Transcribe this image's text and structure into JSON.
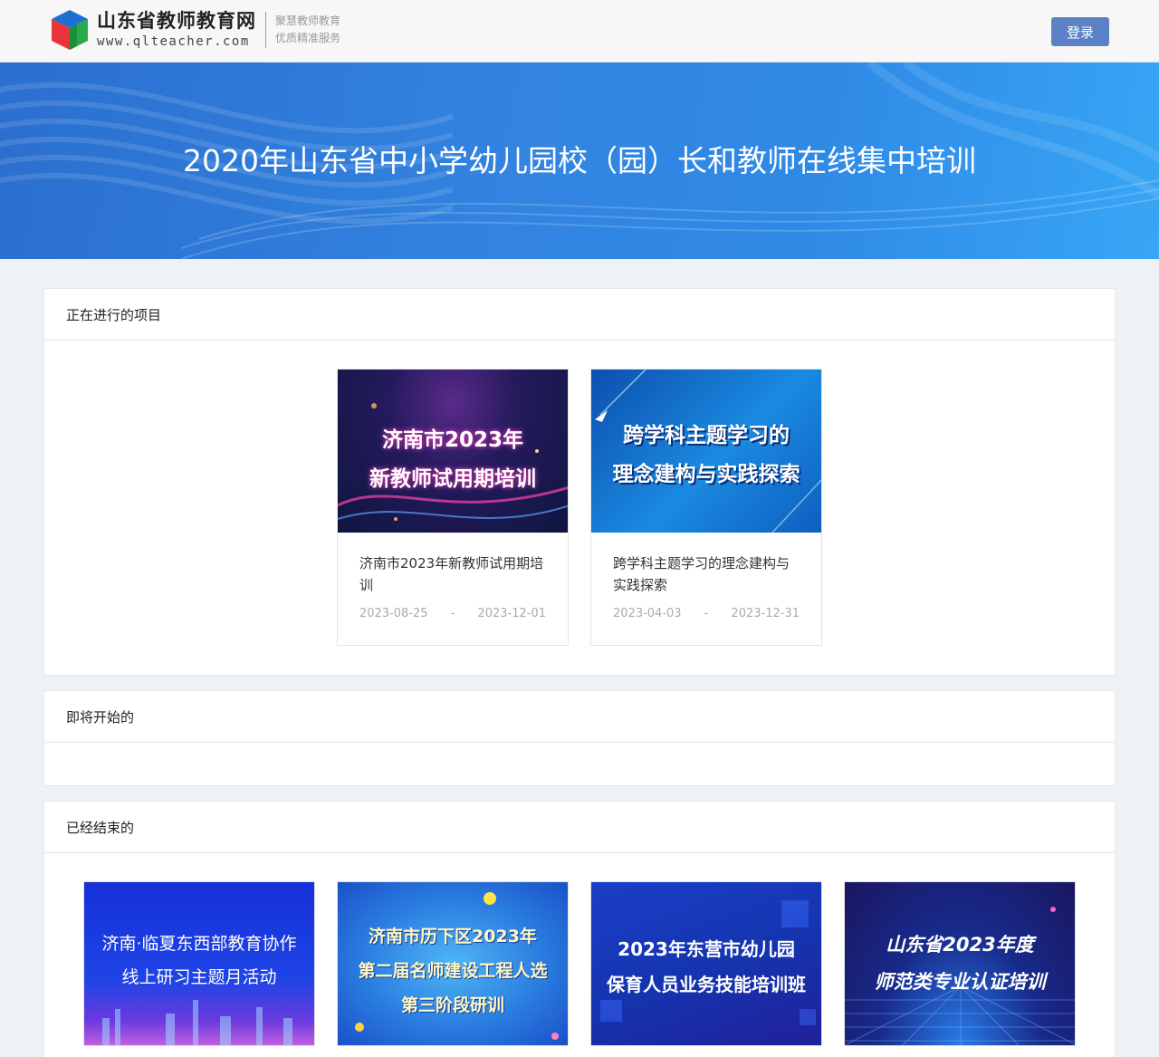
{
  "header": {
    "site_name": "山东省教师教育网",
    "site_url": "www.qlteacher.com",
    "slogan_line1": "聚慧教师教育",
    "slogan_line2": "优质精准服务",
    "login_label": "登录"
  },
  "banner": {
    "title": "2020年山东省中小学幼儿园校（园）长和教师在线集中培训"
  },
  "sections": {
    "ongoing": {
      "title": "正在进行的项目",
      "cards": [
        {
          "cover_line1": "济南市2023年",
          "cover_line2": "新教师试用期培训",
          "title": "济南市2023年新教师试用期培训",
          "start": "2023-08-25",
          "sep": "-",
          "end": "2023-12-01"
        },
        {
          "cover_line1": "跨学科主题学习的",
          "cover_line2": "理念建构与实践探索",
          "title": "跨学科主题学习的理念建构与实践探索",
          "start": "2023-04-03",
          "sep": "-",
          "end": "2023-12-31"
        }
      ]
    },
    "upcoming": {
      "title": "即将开始的"
    },
    "ended": {
      "title": "已经结束的",
      "cards": [
        {
          "cover_line1": "济南·临夏东西部教育协作",
          "cover_line2": "线上研习主题月活动"
        },
        {
          "cover_line1": "济南市历下区2023年",
          "cover_line2": "第二届名师建设工程人选",
          "cover_line3": "第三阶段研训"
        },
        {
          "cover_line1": "2023年东营市幼儿园",
          "cover_line2": "保育人员业务技能培训班"
        },
        {
          "cover_line1": "山东省2023年度",
          "cover_line2": "师范类专业认证培训"
        }
      ]
    }
  },
  "colors": {
    "accent": "#5b82c5",
    "banner_blue": "#3284e0"
  }
}
